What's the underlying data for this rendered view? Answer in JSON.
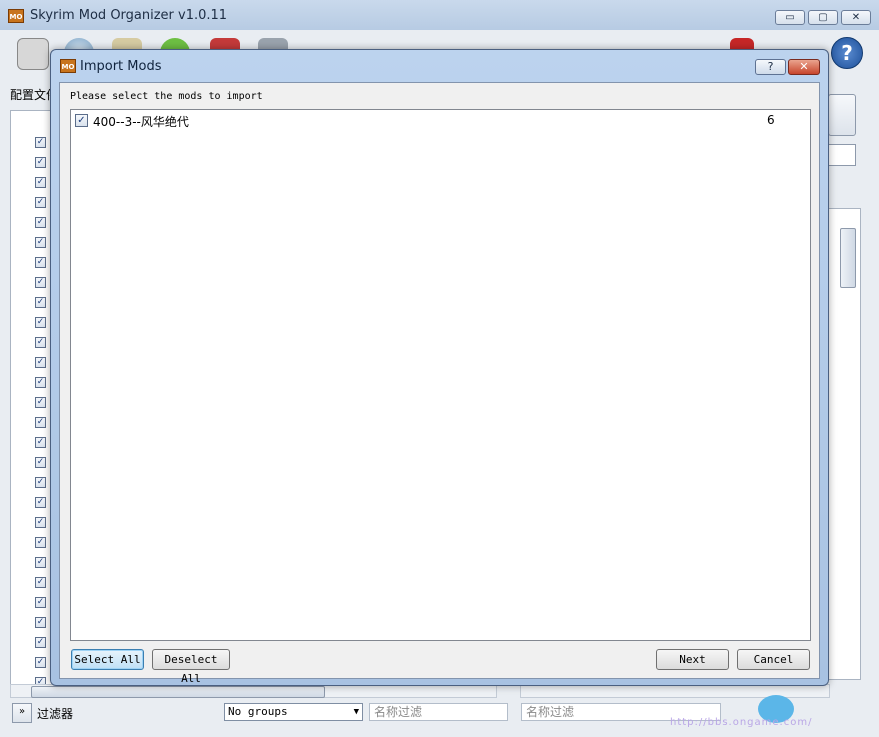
{
  "app": {
    "icon_text": "MO",
    "title": "Skyrim Mod Organizer v1.0.11",
    "controls": {
      "minimize": "▭",
      "maximize": "▢",
      "close": "✕"
    }
  },
  "toolbar": {
    "icons": [
      "install-mod-icon",
      "nexus-globe-icon",
      "profiles-icon",
      "executables-gear-icon",
      "tools-icon",
      "settings-wrench-icon",
      "warning-icon",
      "help-icon"
    ],
    "help_glyph": "?"
  },
  "left_panel": {
    "profile_label": "配置文件",
    "check_glyph": "✓"
  },
  "bottom": {
    "expand_glyph": "»",
    "filter_label": "过滤器",
    "groups_value": "No groups",
    "groups_arrow": "▼",
    "name_filter_placeholder": "名称过滤",
    "name_filter_right_placeholder": "名称过滤"
  },
  "dialog": {
    "icon_text": "MO",
    "title": "Import Mods",
    "help_glyph": "?",
    "close_glyph": "✕",
    "prompt": "Please select the mods to import",
    "mods": [
      {
        "checked": true,
        "name": "400--3--风华绝代",
        "count": "6"
      }
    ],
    "check_glyph": "✓",
    "buttons": {
      "select_all": "Select All",
      "deselect_all": "Deselect All",
      "next": "Next",
      "cancel": "Cancel"
    }
  },
  "watermark": "http://bbs.ongame.com/"
}
